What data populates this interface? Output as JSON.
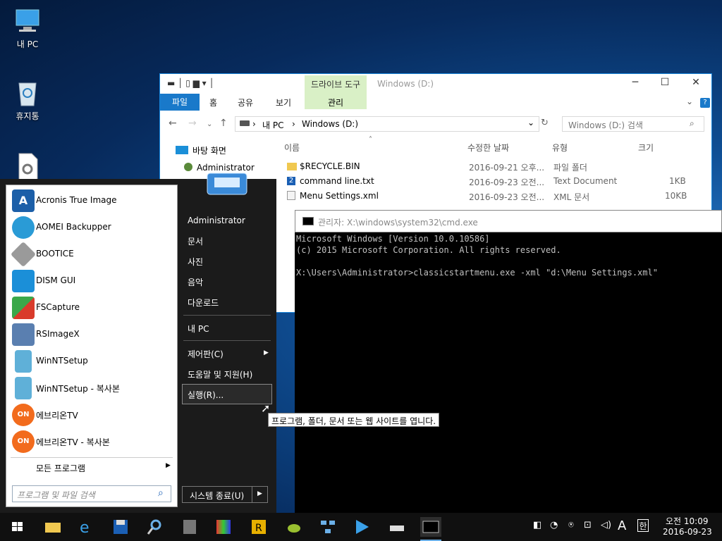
{
  "desktop": {
    "icons": [
      {
        "label": "내 PC",
        "icon": "computer-icon"
      },
      {
        "label": "휴지통",
        "icon": "recycle-bin-icon"
      },
      {
        "label": "",
        "icon": "settings-file-icon"
      }
    ]
  },
  "explorer": {
    "title": "Windows (D:)",
    "context_group": "드라이브 도구",
    "context_tab": "관리",
    "ribbon_tabs": [
      "파일",
      "홈",
      "공유",
      "보기"
    ],
    "breadcrumb": [
      "내 PC",
      "Windows (D:)"
    ],
    "search_placeholder": "Windows (D:) 검색",
    "nav_items": [
      "바탕 화면",
      "Administrator"
    ],
    "columns": [
      "이름",
      "수정한 날짜",
      "유형",
      "크기"
    ],
    "files": [
      {
        "name": "$RECYCLE.BIN",
        "date": "2016-09-21 오후...",
        "type": "파일 폴더",
        "size": ""
      },
      {
        "name": "command line.txt",
        "date": "2016-09-23 오전...",
        "type": "Text Document",
        "size": "1KB"
      },
      {
        "name": "Menu Settings.xml",
        "date": "2016-09-23 오전...",
        "type": "XML 문서",
        "size": "10KB"
      }
    ]
  },
  "start_menu": {
    "programs": [
      {
        "label": "Acronis True Image",
        "color": "#1c5fa8"
      },
      {
        "label": "AOMEI Backupper",
        "color": "#2a9bd6"
      },
      {
        "label": "BOOTICE",
        "color": "#9a9a9a"
      },
      {
        "label": "DISM GUI",
        "color": "#1b8fd8"
      },
      {
        "label": "FSCapture",
        "color": "#d93b2b"
      },
      {
        "label": "RSImageX",
        "color": "#5a7fb0"
      },
      {
        "label": "WinNTSetup",
        "color": "#5fb0d8"
      },
      {
        "label": "WinNTSetup - 복사본",
        "color": "#5fb0d8"
      },
      {
        "label": "에브리온TV",
        "color": "#f26b1d"
      },
      {
        "label": "에브리온TV - 복사본",
        "color": "#f26b1d"
      }
    ],
    "all_programs": "모든 프로그램",
    "search_placeholder": "프로그램 및 파일 검색",
    "right_items": [
      "Administrator",
      "문서",
      "사진",
      "음악",
      "다운로드",
      "내 PC",
      "제어판(C)",
      "도움말 및 지원(H)",
      "실행(R)..."
    ],
    "shutdown": "시스템 종료(U)",
    "tooltip": "프로그램, 폴더, 문서 또는 웹 사이트를 엽니다."
  },
  "cmd": {
    "title": "관리자: X:\\windows\\system32\\cmd.exe",
    "lines": [
      "Microsoft Windows [Version 10.0.10586]",
      "(c) 2015 Microsoft Corporation. All rights reserved.",
      "",
      "X:\\Users\\Administrator>classicstartmenu.exe -xml \"d:\\Menu Settings.xml\""
    ]
  },
  "taskbar": {
    "time": "오전 10:09",
    "date": "2016-09-23",
    "ime": "A",
    "lang": "한"
  }
}
